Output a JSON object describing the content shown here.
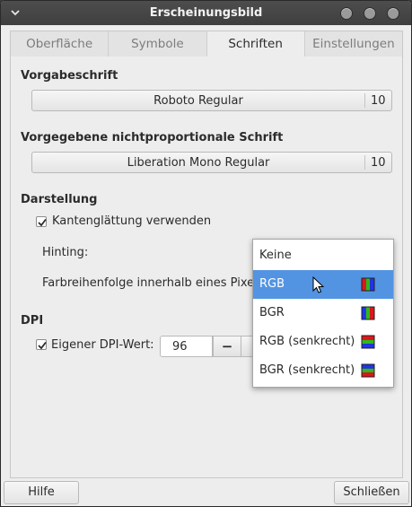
{
  "window": {
    "title": "Erscheinungsbild"
  },
  "tabs": [
    {
      "label": "Oberfläche"
    },
    {
      "label": "Symbole"
    },
    {
      "label": "Schriften"
    },
    {
      "label": "Einstellungen"
    }
  ],
  "default_font": {
    "heading": "Vorgabeschrift",
    "name": "Roboto Regular",
    "size": "10"
  },
  "mono_font": {
    "heading": "Vorgegebene nichtproportionale Schrift",
    "name": "Liberation Mono Regular",
    "size": "10"
  },
  "rendering": {
    "heading": "Darstellung",
    "antialias_label": "Kantenglättung verwenden",
    "antialias_checked": true,
    "hinting_label": "Hinting:",
    "subpixel_label": "Farbreihenfolge innerhalb eines Pixels:"
  },
  "dpi": {
    "heading": "DPI",
    "custom_label": "Eigener DPI-Wert:",
    "custom_checked": true,
    "value": "96",
    "minus_label": "−"
  },
  "dropdown": {
    "options": [
      {
        "label": "Keine",
        "icon": "none"
      },
      {
        "label": "RGB",
        "icon": "rgb-vertical-icon",
        "selected": true
      },
      {
        "label": "BGR",
        "icon": "bgr-vertical-icon"
      },
      {
        "label": "RGB (senkrecht)",
        "icon": "rgb-horizontal-icon"
      },
      {
        "label": "BGR (senkrecht)",
        "icon": "bgr-horizontal-icon"
      }
    ]
  },
  "buttons": {
    "help": "Hilfe",
    "close": "Schließen"
  },
  "colors": {
    "accent": "#5294e2",
    "titlebar": "#444444"
  }
}
